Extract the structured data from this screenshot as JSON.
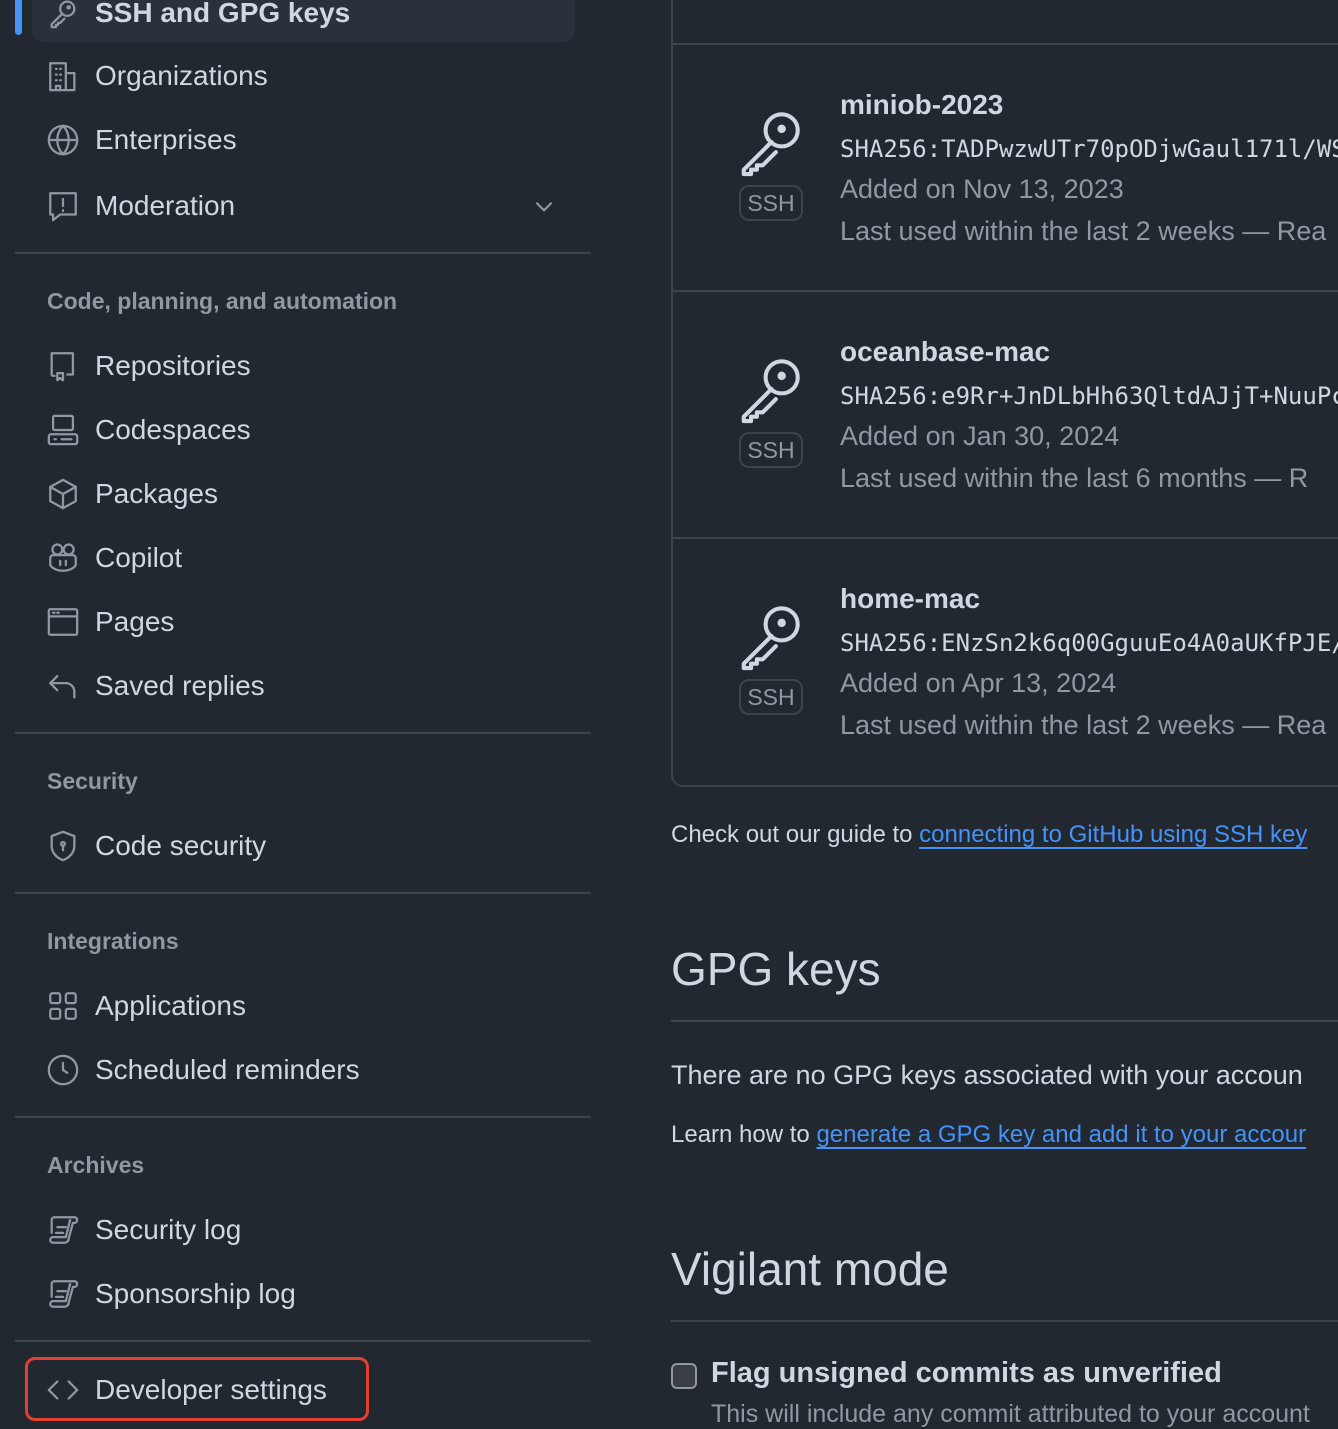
{
  "sidebar": {
    "top_items": [
      {
        "label": "SSH and GPG keys",
        "icon": "key-icon",
        "active": true
      },
      {
        "label": "Organizations",
        "icon": "organization-icon"
      },
      {
        "label": "Enterprises",
        "icon": "globe-icon"
      },
      {
        "label": "Moderation",
        "icon": "report-icon",
        "expandable": true
      }
    ],
    "sections": [
      {
        "title": "Code, planning, and automation",
        "items": [
          {
            "label": "Repositories",
            "icon": "repo-icon"
          },
          {
            "label": "Codespaces",
            "icon": "codespaces-icon"
          },
          {
            "label": "Packages",
            "icon": "package-icon"
          },
          {
            "label": "Copilot",
            "icon": "copilot-icon"
          },
          {
            "label": "Pages",
            "icon": "browser-icon"
          },
          {
            "label": "Saved replies",
            "icon": "reply-icon"
          }
        ]
      },
      {
        "title": "Security",
        "items": [
          {
            "label": "Code security",
            "icon": "shield-lock-icon"
          }
        ]
      },
      {
        "title": "Integrations",
        "items": [
          {
            "label": "Applications",
            "icon": "apps-icon"
          },
          {
            "label": "Scheduled reminders",
            "icon": "clock-icon"
          }
        ]
      },
      {
        "title": "Archives",
        "items": [
          {
            "label": "Security log",
            "icon": "log-icon"
          },
          {
            "label": "Sponsorship log",
            "icon": "log-icon"
          }
        ]
      }
    ],
    "developer_settings": {
      "label": "Developer settings",
      "icon": "code-icon"
    },
    "highlight_color": "#e5402f",
    "accent_color": "#4493f8"
  },
  "ssh_keys": [
    {
      "title": "miniob-2023",
      "fingerprint": "SHA256:TADPwzwUTr70pODjwGaul171l/WS",
      "added": "Added on Nov 13, 2023",
      "last_used": "Last used within the last 2 weeks — Rea",
      "badge": "SSH"
    },
    {
      "title": "oceanbase-mac",
      "fingerprint": "SHA256:e9Rr+JnDLbHh63QltdAJjT+NuuPc",
      "added": "Added on Jan 30, 2024",
      "last_used": "Last used within the last 6 months — R",
      "badge": "SSH"
    },
    {
      "title": "home-mac",
      "fingerprint": "SHA256:ENzSn2k6q00GguuEo4A0aUKfPJE/",
      "added": "Added on Apr 13, 2024",
      "last_used": "Last used within the last 2 weeks — Rea",
      "badge": "SSH"
    }
  ],
  "ssh_guide": {
    "prefix": "Check out our guide to ",
    "link": "connecting to GitHub using SSH key"
  },
  "gpg": {
    "heading": "GPG keys",
    "empty_text": "There are no GPG keys associated with your accoun",
    "learn_prefix": "Learn how to ",
    "learn_link": "generate a GPG key and add it to your accour"
  },
  "vigilant": {
    "heading": "Vigilant mode",
    "checkbox_label": "Flag unsigned commits as unverified",
    "checkbox_checked": false,
    "description": "This will include any commit attributed to your account"
  }
}
